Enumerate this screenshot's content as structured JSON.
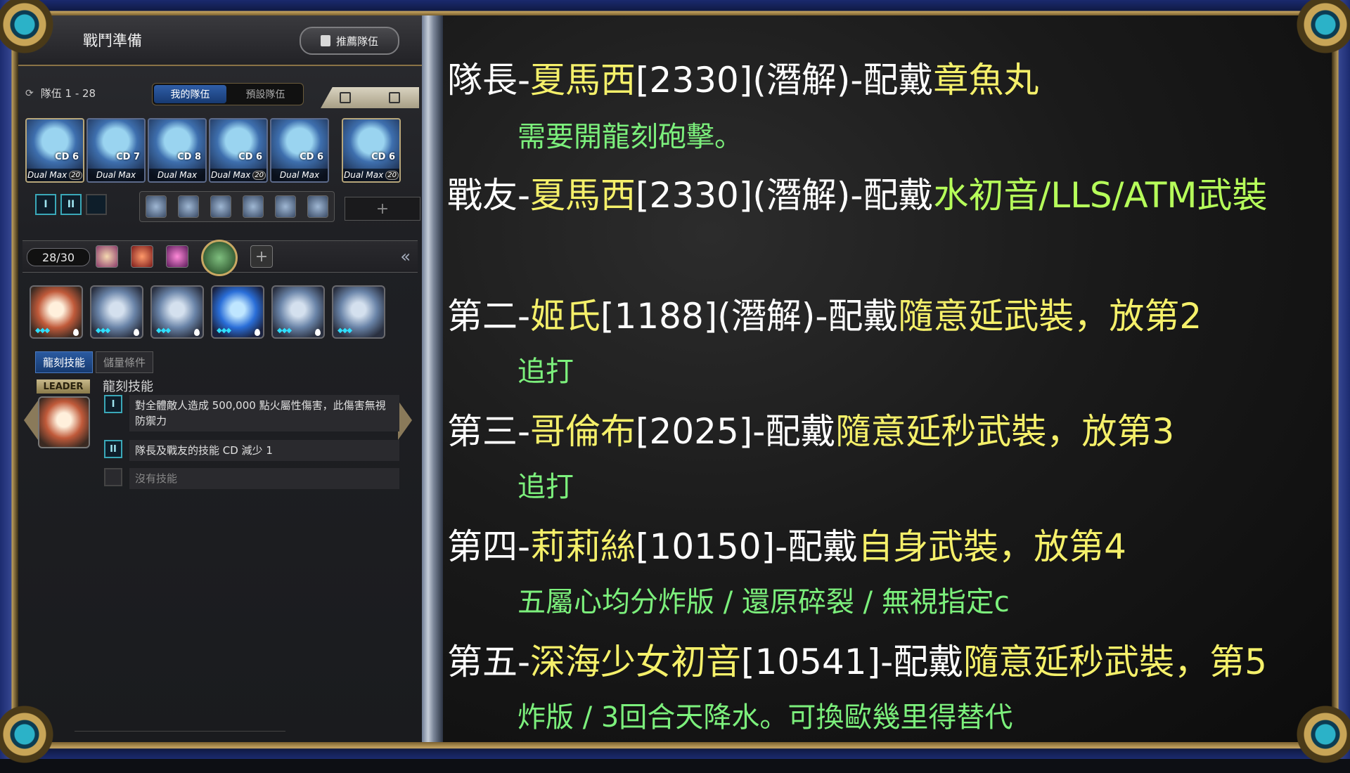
{
  "header": {
    "title": "戰鬥準備",
    "recommend_label": "推薦隊伍"
  },
  "team": {
    "label": "隊伍 1 - 28",
    "tabs": [
      "我的隊伍",
      "預設隊伍"
    ]
  },
  "cards": [
    {
      "cd": "CD 6",
      "max": "Dual Max",
      "level": "20",
      "role": "leader"
    },
    {
      "cd": "CD 7",
      "max": "Dual Max",
      "level": "",
      "role": "member"
    },
    {
      "cd": "CD 8",
      "max": "Dual Max",
      "level": "",
      "role": "member"
    },
    {
      "cd": "CD 6",
      "max": "Dual Max",
      "level": "20",
      "role": "member"
    },
    {
      "cd": "CD 6",
      "max": "Dual Max",
      "level": "",
      "role": "member"
    },
    {
      "cd": "CD 6",
      "max": "Dual Max",
      "level": "20",
      "role": "friend"
    }
  ],
  "roman_buttons": [
    "I",
    "II"
  ],
  "energy": {
    "count": "28/30"
  },
  "skill_tabs": [
    "龍刻技能",
    "儲量條件"
  ],
  "leader_badge": "LEADER",
  "skill_section_title": "龍刻技能",
  "skills": [
    {
      "num": "I",
      "text": "對全體敵人造成 500,000 點火屬性傷害，此傷害無視防禦力"
    },
    {
      "num": "II",
      "text": "隊長及戰友的技能 CD 減少 1"
    },
    {
      "num": "",
      "text": "沒有技能"
    }
  ],
  "guide": {
    "line1": {
      "prefix": "隊長-",
      "name": "夏馬西",
      "mid": "[2330](潛解)-配戴",
      "equip": "章魚丸"
    },
    "line1_note": "需要開龍刻砲擊。",
    "line2": {
      "prefix": "戰友-",
      "name": "夏馬西",
      "mid": "[2330](潛解)-配戴",
      "equip": "水初音/LLS/ATM武裝"
    },
    "line3": {
      "prefix": "第二-",
      "name": "姬氏",
      "mid": "[1188](潛解)-配戴",
      "equip": "隨意延武裝，放第2"
    },
    "line3_note": "追打",
    "line4": {
      "prefix": "第三-",
      "name": "哥倫布",
      "mid": "[2025]-配戴",
      "equip": "隨意延秒武裝，放第3"
    },
    "line4_note": "追打",
    "line5": {
      "prefix": "第四-",
      "name": "莉莉絲",
      "mid": "[10150]-配戴",
      "equip": "自身武裝，放第4"
    },
    "line5_note": "五屬心均分炸版 / 還原碎裂 / 無視指定c",
    "line6": {
      "prefix": "第五-",
      "name": "深海少女初音",
      "mid": "[10541]-配戴",
      "equip": "隨意延秒武裝，第5"
    },
    "line6_note": "炸版 / 3回合天降水。可換歐幾里得替代"
  },
  "colors": {
    "name_highlight": "#f5f06a",
    "note_green": "#7cf07c",
    "friend_equip": "#b6ff5a",
    "tab_active": "#2f5ea8"
  }
}
